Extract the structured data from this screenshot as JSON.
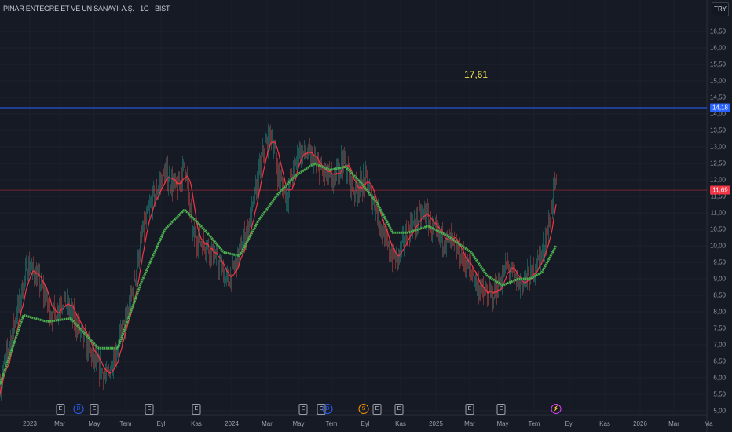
{
  "header": {
    "title": "PINAR ENTEGRE ET VE UN SANAYİİ A.Ş. · 1G · BIST",
    "currency_button": "TRY"
  },
  "annotation": "17,61",
  "price_axis": {
    "ticks": [
      "16,50",
      "16,00",
      "15,50",
      "15,00",
      "14,50",
      "14,00",
      "13,50",
      "13,00",
      "12,50",
      "12,00",
      "11,50",
      "11,00",
      "10,50",
      "10,00",
      "9,50",
      "9,00",
      "8,50",
      "8,00",
      "7,50",
      "7,00",
      "6,50",
      "6,00",
      "5,50",
      "5,00"
    ],
    "range": [
      5.0,
      16.5
    ]
  },
  "time_axis": {
    "labels": [
      "2023",
      "Mar",
      "May",
      "Tem",
      "Eyl",
      "Kas",
      "2024",
      "Mar",
      "May",
      "Tem",
      "Eyl",
      "Kas",
      "2025",
      "Mar",
      "May",
      "Tem",
      "Eyl",
      "Kas",
      "2026",
      "Mar",
      "Ma"
    ]
  },
  "horizontal_line": {
    "value": 14.18,
    "label": "14,18",
    "color": "#2962ff"
  },
  "last_price": {
    "value": 11.69,
    "label": "11,69",
    "color": "#f23645"
  },
  "events": [
    {
      "type": "E",
      "icon": "earnings-icon"
    },
    {
      "type": "D",
      "icon": "dividend-icon"
    },
    {
      "type": "E",
      "icon": "earnings-icon"
    },
    {
      "type": "E",
      "icon": "earnings-icon"
    },
    {
      "type": "E",
      "icon": "earnings-icon"
    },
    {
      "type": "E",
      "icon": "earnings-icon"
    },
    {
      "type": "E",
      "icon": "earnings-icon"
    },
    {
      "type": "D",
      "icon": "dividend-icon"
    },
    {
      "type": "S",
      "icon": "split-icon"
    },
    {
      "type": "E",
      "icon": "earnings-icon"
    },
    {
      "type": "E",
      "icon": "earnings-icon"
    },
    {
      "type": "E",
      "icon": "earnings-icon"
    },
    {
      "type": "E",
      "icon": "earnings-icon"
    },
    {
      "type": "⚡",
      "icon": "lightning-icon"
    }
  ],
  "chart_data": {
    "type": "candlestick",
    "close_keypoints": [
      [
        0,
        5.8
      ],
      [
        20,
        7.9
      ],
      [
        35,
        9.4
      ],
      [
        50,
        8.9
      ],
      [
        65,
        7.9
      ],
      [
        80,
        8.4
      ],
      [
        100,
        7.5
      ],
      [
        120,
        6.5
      ],
      [
        135,
        6.0
      ],
      [
        150,
        7.0
      ],
      [
        165,
        8.2
      ],
      [
        180,
        10.3
      ],
      [
        195,
        11.5
      ],
      [
        210,
        12.2
      ],
      [
        225,
        11.7
      ],
      [
        235,
        12.5
      ],
      [
        245,
        10.3
      ],
      [
        260,
        10.1
      ],
      [
        275,
        9.6
      ],
      [
        290,
        8.9
      ],
      [
        305,
        9.8
      ],
      [
        320,
        11.0
      ],
      [
        335,
        12.9
      ],
      [
        345,
        13.4
      ],
      [
        355,
        12.0
      ],
      [
        365,
        11.5
      ],
      [
        380,
        12.9
      ],
      [
        395,
        12.7
      ],
      [
        410,
        12.2
      ],
      [
        425,
        12.0
      ],
      [
        435,
        12.7
      ],
      [
        450,
        11.7
      ],
      [
        465,
        12.0
      ],
      [
        480,
        11.0
      ],
      [
        495,
        9.8
      ],
      [
        505,
        9.6
      ],
      [
        520,
        10.5
      ],
      [
        540,
        11.0
      ],
      [
        555,
        10.3
      ],
      [
        575,
        10.1
      ],
      [
        595,
        9.4
      ],
      [
        615,
        8.5
      ],
      [
        630,
        8.6
      ],
      [
        645,
        9.4
      ],
      [
        660,
        8.8
      ],
      [
        675,
        9.1
      ],
      [
        690,
        9.8
      ],
      [
        700,
        10.8
      ],
      [
        705,
        11.9
      ],
      [
        708,
        11.69
      ]
    ],
    "slow_ma_keypoints": [
      [
        0,
        5.8
      ],
      [
        30,
        7.9
      ],
      [
        60,
        7.7
      ],
      [
        90,
        7.8
      ],
      [
        125,
        6.9
      ],
      [
        150,
        6.9
      ],
      [
        180,
        8.9
      ],
      [
        210,
        10.5
      ],
      [
        235,
        11.1
      ],
      [
        260,
        10.5
      ],
      [
        285,
        9.8
      ],
      [
        305,
        9.7
      ],
      [
        330,
        10.8
      ],
      [
        355,
        11.6
      ],
      [
        375,
        12.1
      ],
      [
        400,
        12.5
      ],
      [
        420,
        12.3
      ],
      [
        440,
        12.4
      ],
      [
        460,
        11.9
      ],
      [
        480,
        11.3
      ],
      [
        500,
        10.4
      ],
      [
        520,
        10.4
      ],
      [
        545,
        10.6
      ],
      [
        570,
        10.3
      ],
      [
        600,
        9.8
      ],
      [
        620,
        9.1
      ],
      [
        640,
        8.8
      ],
      [
        660,
        9.0
      ],
      [
        675,
        9.0
      ],
      [
        690,
        9.2
      ],
      [
        708,
        10.0
      ]
    ],
    "fast_ma_color": "#f23645",
    "slow_ma_color": "#4caf50"
  }
}
